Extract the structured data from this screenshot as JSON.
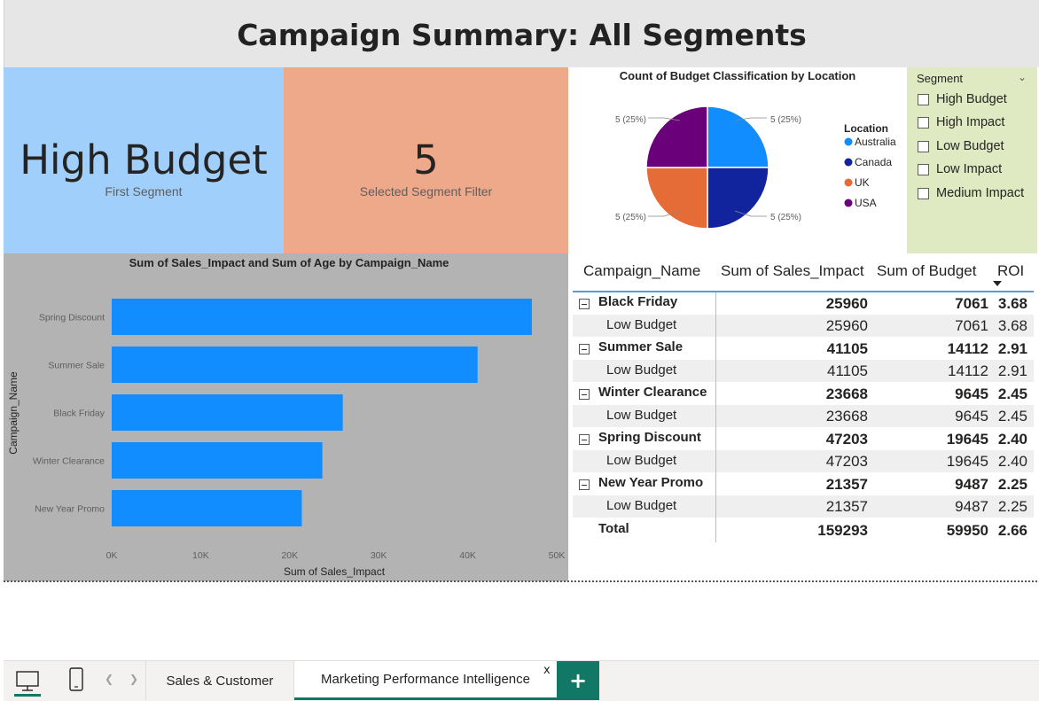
{
  "title": "Campaign Summary: All Segments",
  "cards": [
    {
      "value": "High Budget",
      "label": "First Segment"
    },
    {
      "value": "5",
      "label": "Selected Segment Filter"
    }
  ],
  "pie": {
    "title": "Count of Budget Classification by Location",
    "legend_title": "Location",
    "slice_labels": [
      "5 (25%)",
      "5 (25%)",
      "5 (25%)",
      "5 (25%)"
    ]
  },
  "slicer": {
    "title": "Segment",
    "items": [
      "High Budget",
      "High Impact",
      "Low Budget",
      "Low Impact",
      "Medium Impact"
    ]
  },
  "table": {
    "headers": [
      "Campaign_Name",
      "Sum of Sales_Impact",
      "Sum of Budget",
      "ROI"
    ],
    "rows": [
      {
        "name": "Black Friday",
        "sales": "25960",
        "budget": "7061",
        "roi": "3.68",
        "child": {
          "name": "Low Budget",
          "sales": "25960",
          "budget": "7061",
          "roi": "3.68"
        }
      },
      {
        "name": "Summer Sale",
        "sales": "41105",
        "budget": "14112",
        "roi": "2.91",
        "child": {
          "name": "Low Budget",
          "sales": "41105",
          "budget": "14112",
          "roi": "2.91"
        }
      },
      {
        "name": "Winter Clearance",
        "sales": "23668",
        "budget": "9645",
        "roi": "2.45",
        "child": {
          "name": "Low Budget",
          "sales": "23668",
          "budget": "9645",
          "roi": "2.45"
        }
      },
      {
        "name": "Spring Discount",
        "sales": "47203",
        "budget": "19645",
        "roi": "2.40",
        "child": {
          "name": "Low Budget",
          "sales": "47203",
          "budget": "19645",
          "roi": "2.40"
        }
      },
      {
        "name": "New Year Promo",
        "sales": "21357",
        "budget": "9487",
        "roi": "2.25",
        "child": {
          "name": "Low Budget",
          "sales": "21357",
          "budget": "9487",
          "roi": "2.25"
        }
      }
    ],
    "total": {
      "name": "Total",
      "sales": "159293",
      "budget": "59950",
      "roi": "2.66"
    }
  },
  "tabs": {
    "tab1": "Sales & Customer",
    "tab2": "Marketing Performance Intelligence",
    "close": "x",
    "add": "+"
  },
  "colors": {
    "australia": "#118dff",
    "canada": "#12239e",
    "uk": "#e66c37",
    "usa": "#6b007b",
    "bar": "#118dff",
    "accent": "#117865"
  },
  "chart_data": [
    {
      "type": "pie",
      "title": "Count of Budget Classification by Location",
      "legend_title": "Location",
      "legend_position": "right",
      "categories": [
        "Australia",
        "Canada",
        "UK",
        "USA"
      ],
      "values": [
        5,
        5,
        5,
        5
      ],
      "percent": [
        25,
        25,
        25,
        25
      ],
      "colors": [
        "#118dff",
        "#12239e",
        "#e66c37",
        "#6b007b"
      ]
    },
    {
      "type": "bar",
      "orientation": "horizontal",
      "title": "Sum of Sales_Impact and Sum of Age by Campaign_Name",
      "xlabel": "Sum of Sales_Impact",
      "ylabel": "Campaign_Name",
      "categories": [
        "Spring Discount",
        "Summer Sale",
        "Black Friday",
        "Winter Clearance",
        "New Year Promo"
      ],
      "values": [
        47203,
        41105,
        25960,
        23668,
        21357
      ],
      "xticks": [
        "0K",
        "10K",
        "20K",
        "30K",
        "40K",
        "50K"
      ],
      "xlim": [
        0,
        50000
      ],
      "grid": false
    }
  ]
}
